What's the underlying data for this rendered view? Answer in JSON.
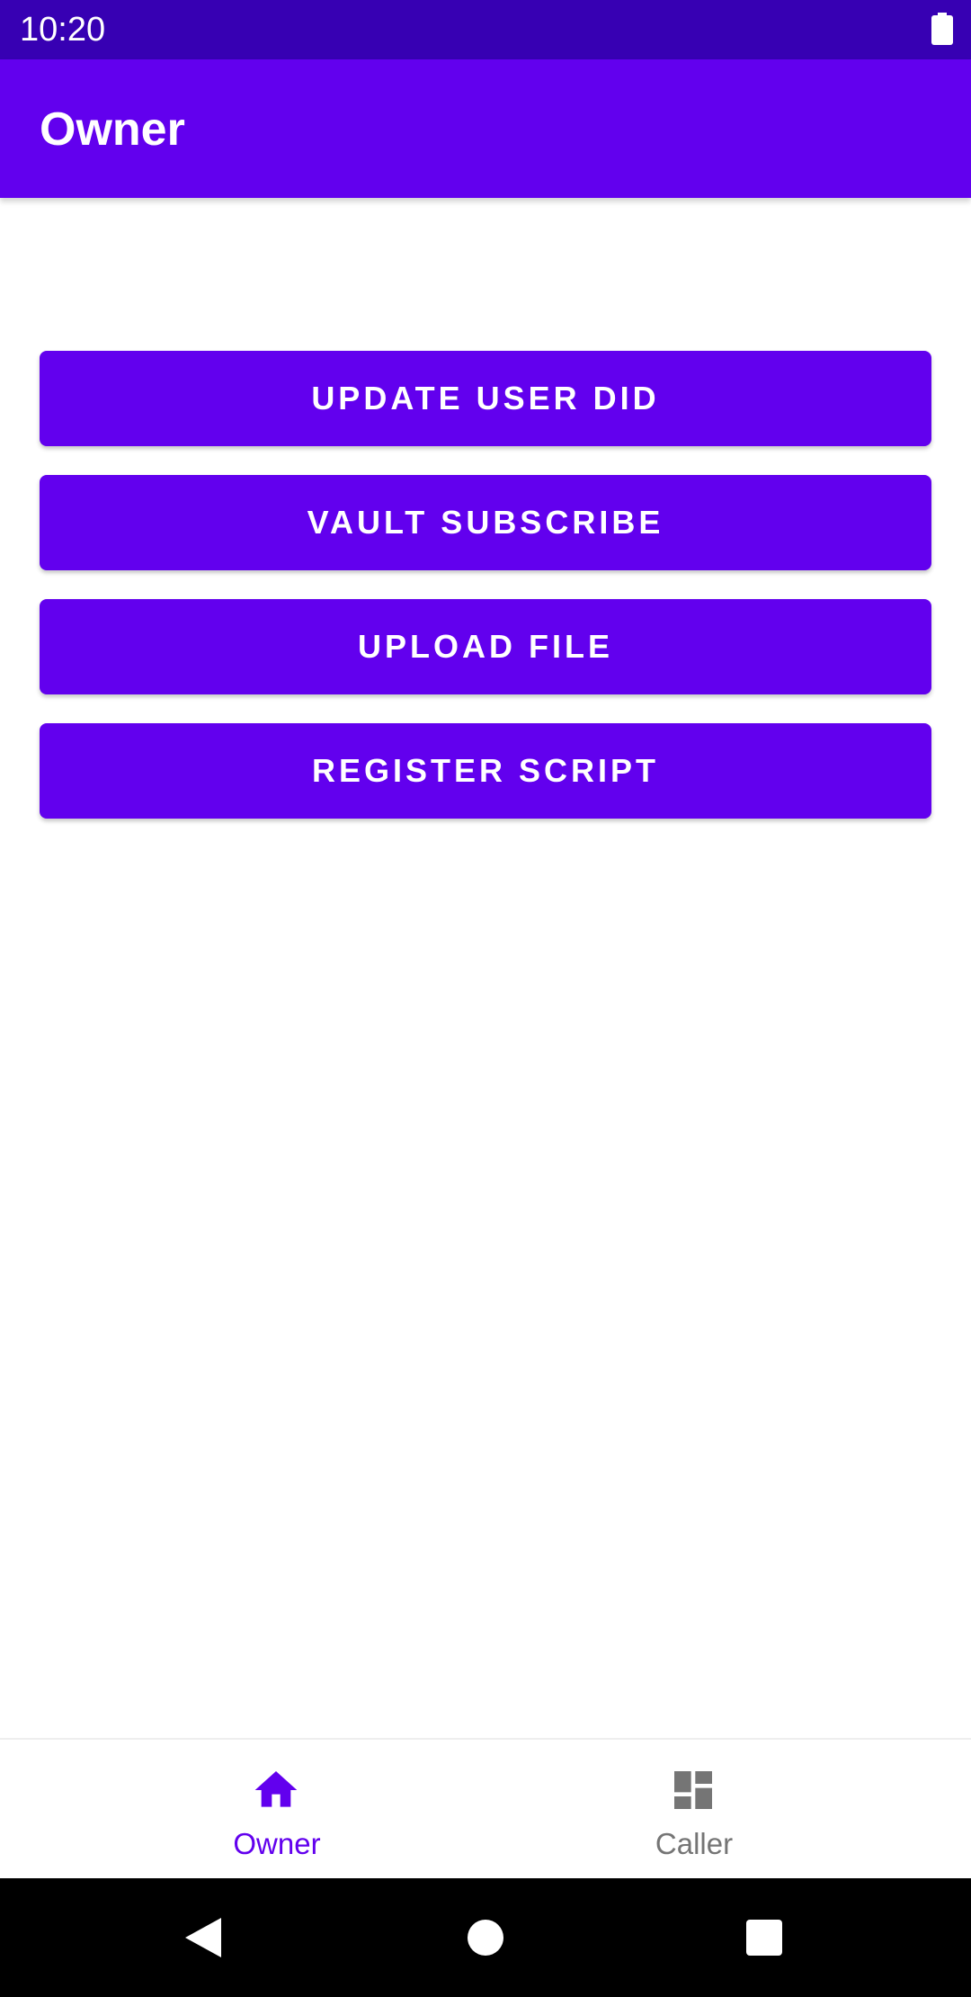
{
  "status_bar": {
    "time": "10:20",
    "battery_icon": "battery-full-icon"
  },
  "app_bar": {
    "title": "Owner"
  },
  "actions": [
    {
      "label": "UPDATE USER DID"
    },
    {
      "label": "VAULT SUBSCRIBE"
    },
    {
      "label": "UPLOAD FILE"
    },
    {
      "label": "REGISTER SCRIPT"
    }
  ],
  "bottom_nav": {
    "items": [
      {
        "label": "Owner",
        "icon": "home-icon",
        "selected": true
      },
      {
        "label": "Caller",
        "icon": "dashboard-icon",
        "selected": false
      }
    ]
  },
  "system_nav": {
    "back_icon": "back-icon",
    "home_icon": "home-circle-icon",
    "recents_icon": "recents-icon"
  },
  "colors": {
    "primary": "#6200ee",
    "primary_dark": "#3700b3",
    "inactive": "#757575",
    "background": "#ffffff"
  }
}
